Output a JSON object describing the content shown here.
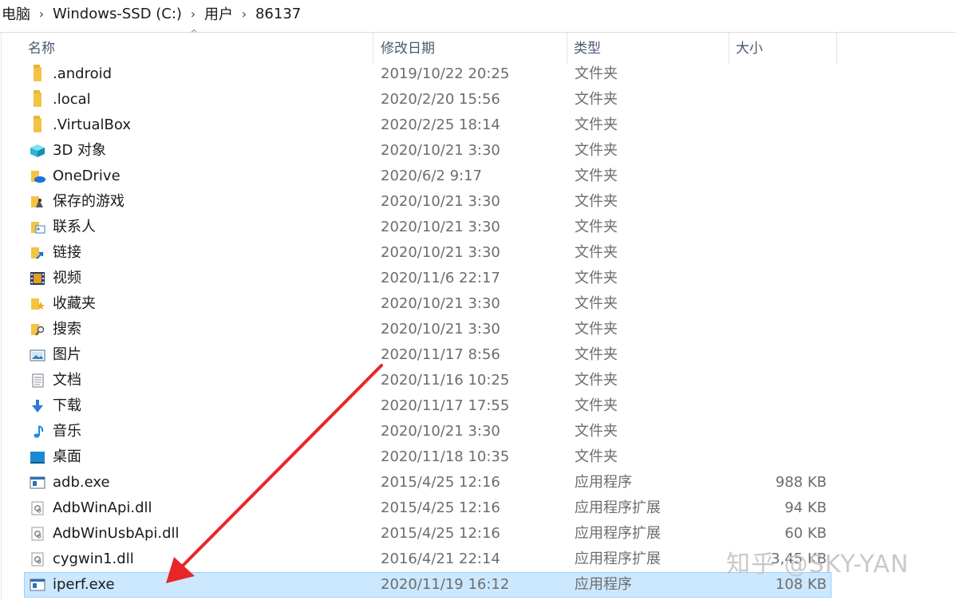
{
  "breadcrumb": [
    "电脑",
    "Windows-SSD (C:)",
    "用户",
    "86137"
  ],
  "columns": {
    "name": "名称",
    "date": "修改日期",
    "type": "类型",
    "size": "大小"
  },
  "rows": [
    {
      "name": ".android",
      "date": "2019/10/22 20:25",
      "type": "文件夹",
      "size": "",
      "icon": "folder-icon"
    },
    {
      "name": ".local",
      "date": "2020/2/20 15:56",
      "type": "文件夹",
      "size": "",
      "icon": "folder-icon"
    },
    {
      "name": ".VirtualBox",
      "date": "2020/2/25 18:14",
      "type": "文件夹",
      "size": "",
      "icon": "folder-icon"
    },
    {
      "name": "3D 对象",
      "date": "2020/10/21 3:30",
      "type": "文件夹",
      "size": "",
      "icon": "3d-objects-icon"
    },
    {
      "name": "OneDrive",
      "date": "2020/6/2 9:17",
      "type": "文件夹",
      "size": "",
      "icon": "onedrive-folder-icon"
    },
    {
      "name": "保存的游戏",
      "date": "2020/10/21 3:30",
      "type": "文件夹",
      "size": "",
      "icon": "saved-games-icon"
    },
    {
      "name": "联系人",
      "date": "2020/10/21 3:30",
      "type": "文件夹",
      "size": "",
      "icon": "contacts-icon"
    },
    {
      "name": "链接",
      "date": "2020/10/21 3:30",
      "type": "文件夹",
      "size": "",
      "icon": "links-icon"
    },
    {
      "name": "视频",
      "date": "2020/11/6 22:17",
      "type": "文件夹",
      "size": "",
      "icon": "videos-icon"
    },
    {
      "name": "收藏夹",
      "date": "2020/10/21 3:30",
      "type": "文件夹",
      "size": "",
      "icon": "favorites-icon"
    },
    {
      "name": "搜索",
      "date": "2020/10/21 3:30",
      "type": "文件夹",
      "size": "",
      "icon": "searches-icon"
    },
    {
      "name": "图片",
      "date": "2020/11/17 8:56",
      "type": "文件夹",
      "size": "",
      "icon": "pictures-icon"
    },
    {
      "name": "文档",
      "date": "2020/11/16 10:25",
      "type": "文件夹",
      "size": "",
      "icon": "documents-icon"
    },
    {
      "name": "下载",
      "date": "2020/11/17 17:55",
      "type": "文件夹",
      "size": "",
      "icon": "downloads-icon"
    },
    {
      "name": "音乐",
      "date": "2020/10/21 3:30",
      "type": "文件夹",
      "size": "",
      "icon": "music-icon"
    },
    {
      "name": "桌面",
      "date": "2020/11/18 10:35",
      "type": "文件夹",
      "size": "",
      "icon": "desktop-icon"
    },
    {
      "name": "adb.exe",
      "date": "2015/4/25 12:16",
      "type": "应用程序",
      "size": "988 KB",
      "icon": "exe-icon"
    },
    {
      "name": "AdbWinApi.dll",
      "date": "2015/4/25 12:16",
      "type": "应用程序扩展",
      "size": "94 KB",
      "icon": "dll-icon"
    },
    {
      "name": "AdbWinUsbApi.dll",
      "date": "2015/4/25 12:16",
      "type": "应用程序扩展",
      "size": "60 KB",
      "icon": "dll-icon"
    },
    {
      "name": "cygwin1.dll",
      "date": "2016/4/21 22:14",
      "type": "应用程序扩展",
      "size": "3,45 KB",
      "icon": "dll-icon"
    },
    {
      "name": "iperf.exe",
      "date": "2020/11/19 16:12",
      "type": "应用程序",
      "size": "108 KB",
      "icon": "exe-icon",
      "selected": true
    }
  ],
  "watermark": "知乎 @SKY-YAN",
  "colors": {
    "selection": "#cce8ff",
    "arrow": "#e8262a",
    "folder": "#f3c443"
  }
}
